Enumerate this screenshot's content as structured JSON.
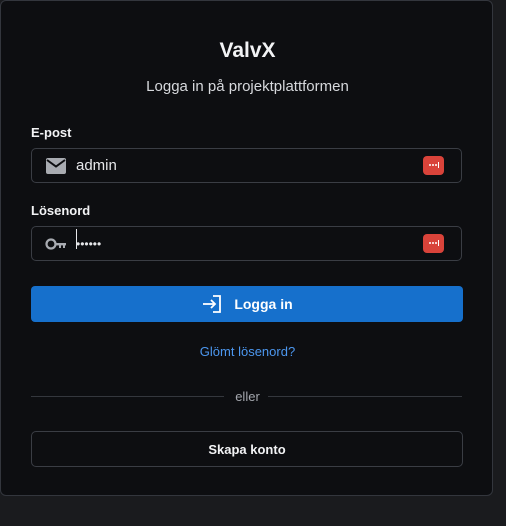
{
  "app": {
    "title": "ValvX",
    "subtitle": "Logga in på projektplattformen"
  },
  "form": {
    "email": {
      "label": "E-post",
      "value": "admin",
      "icon": "envelope-icon"
    },
    "password": {
      "label": "Lösenord",
      "value": "••••••",
      "icon": "key-icon"
    },
    "password_manager_icon": "password-manager-icon",
    "login_button_label": "Logga in",
    "login_button_icon": "login-arrow-icon",
    "forgot_password_link": "Glömt lösenord?",
    "divider_text": "eller",
    "create_account_label": "Skapa konto"
  },
  "colors": {
    "background": "#0d0e11",
    "primary": "#1670cc",
    "link": "#4c97ef",
    "password_manager": "#d9433a",
    "border": "#3a3d44"
  }
}
